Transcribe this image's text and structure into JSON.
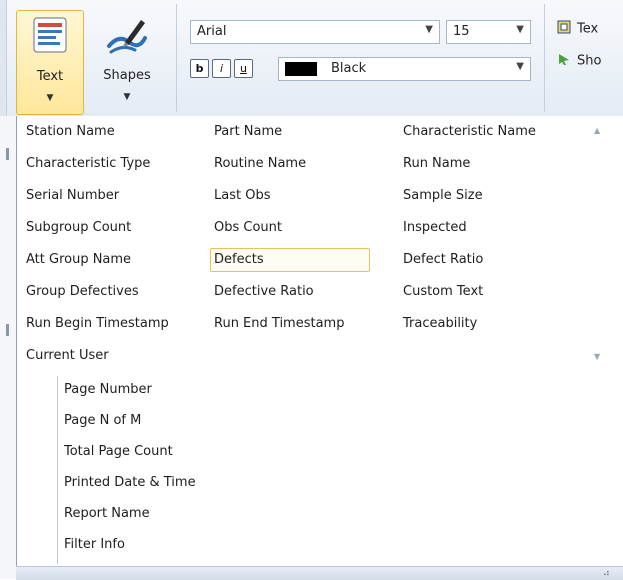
{
  "ribbon": {
    "text_button": {
      "label": "Text",
      "icon": "text-block-icon"
    },
    "shapes_button": {
      "label": "Shapes",
      "icon": "pen-shapes-icon"
    },
    "font_family": {
      "value": "Arial"
    },
    "font_size": {
      "value": "15"
    },
    "format_buttons": [
      {
        "glyph": "b",
        "icon": "bold-icon"
      },
      {
        "glyph": "i",
        "icon": "italic-icon"
      },
      {
        "glyph": "u",
        "icon": "underline-icon"
      }
    ],
    "font_color": {
      "value": "Black",
      "swatch": "#000000"
    },
    "side_commands": [
      {
        "label": "Tex",
        "icon": "text-frame-icon"
      },
      {
        "label": "Sho",
        "icon": "show-arrow-icon"
      }
    ]
  },
  "menu": {
    "fields": [
      "Station Name",
      "Part Name",
      "Characteristic Name",
      "Characteristic Type",
      "Routine Name",
      "Run Name",
      "Serial Number",
      "Last Obs",
      "Sample Size",
      "Subgroup Count",
      "Obs Count",
      "Inspected",
      "Att Group Name",
      "Defects",
      "Defect Ratio",
      "Group Defectives",
      "Defective Ratio",
      "Custom Text",
      "Run Begin Timestamp",
      "Run End Timestamp",
      "Traceability",
      "Current User"
    ],
    "hovered_field": "Defects",
    "page_fields": [
      "Page Number",
      "Page N of M",
      "Total Page Count",
      "Printed Date & Time",
      "Report Name",
      "Filter Info"
    ]
  },
  "colors": {
    "accent_border": "#e8c25c",
    "ribbon_bg": "#e4ebf4"
  }
}
